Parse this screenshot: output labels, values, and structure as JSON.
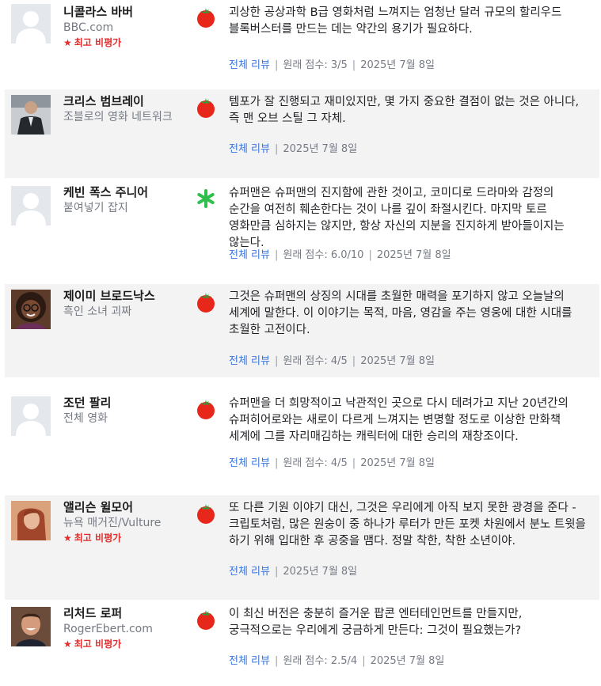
{
  "reviews": [
    {
      "critic": "니콜라스 바버",
      "publication": "BBC.com",
      "top_critic": "최고 비평가",
      "sentiment": "fresh",
      "avatar": "default-avatar",
      "quote": "괴상한 공상과학 B급 영화처럼 느껴지는 엄청난 달러 규모의 할리우드 블록버스터를 만드는 데는 약간의 용기가 필요하다.",
      "full_review": "전체 리뷰",
      "original_score": "원래 점수: 3/5",
      "date": "2025년 7월 8일"
    },
    {
      "critic": "크리스 범브레이",
      "publication": "조블로의 영화 네트워크",
      "top_critic": "",
      "sentiment": "fresh",
      "avatar": "photo-dark-suit",
      "quote": "템포가 잘 진행되고 재미있지만, 몇 가지 중요한 결점이 없는 것은 아니다, 즉 맨 오브 스틸 그 자체.",
      "full_review": "전체 리뷰",
      "original_score": "",
      "date": "2025년 7월 8일"
    },
    {
      "critic": "케빈 폭스 주니어",
      "publication": "붙여넣기 잡지",
      "top_critic": "",
      "sentiment": "rotten",
      "avatar": "default-avatar",
      "quote": "슈퍼맨은 슈퍼맨의 진지함에 관한 것이고, 코미디로 드라마와 감정의 순간을 여전히 훼손한다는 것이 나를 깊이 좌절시킨다. 마지막 토르 영화만큼 심하지는 않지만, 항상 자신의 지분을 진지하게 받아들이지는 않는다.",
      "full_review": "전체 리뷰",
      "original_score": "원래 점수: 6.0/10",
      "date": "2025년 7월 8일"
    },
    {
      "critic": "제이미 브로드낙스",
      "publication": "흑인 소녀 괴짜",
      "top_critic": "",
      "sentiment": "fresh",
      "avatar": "photo-woman-glasses",
      "quote": "그것은 슈퍼맨의 상징의 시대를 초월한 매력을 포기하지 않고 오늘날의 세계에 말한다. 이 이야기는 목적, 마음, 영감을 주는 영웅에 대한 시대를 초월한 고전이다.",
      "full_review": "전체 리뷰",
      "original_score": "원래 점수: 4/5",
      "date": "2025년 7월 8일"
    },
    {
      "critic": "조던 팔리",
      "publication": "전체 영화",
      "top_critic": "",
      "sentiment": "fresh",
      "avatar": "default-avatar",
      "quote": "슈퍼맨을 더 희망적이고 낙관적인 곳으로 다시 데려가고 지난 20년간의 슈퍼히어로와는 새로이 다르게 느껴지는 변명할 정도로 이상한 만화책 세계에 그를 자리매김하는 캐릭터에 대한 승리의 재창조이다.",
      "full_review": "전체 리뷰",
      "original_score": "원래 점수: 4/5",
      "date": "2025년 7월 8일"
    },
    {
      "critic": "앨리슨 윌모어",
      "publication": "뉴욕 매거진/Vulture",
      "top_critic": "최고 비평가",
      "sentiment": "fresh",
      "avatar": "photo-woman-red-hair",
      "quote": "또 다른 기원 이야기 대신, 그것은 우리에게 아직 보지 못한 광경을 준다 - 크립토처럼, 많은 원숭이 중 하나가 루터가 만든 포켓 차원에서 분노 트윗을 하기 위해 입대한 후 공중을 맴다. 정말 착한, 착한 소년이야.",
      "full_review": "전체 리뷰",
      "original_score": "",
      "date": "2025년 7월 8일"
    },
    {
      "critic": "리처드 로퍼",
      "publication": "RogerEbert.com",
      "top_critic": "최고 비평가",
      "sentiment": "fresh",
      "avatar": "photo-man-smiling",
      "quote": "이 최신 버전은 충분히 즐거운 팝콘 엔터테인먼트를 만들지만, 궁극적으로는 우리에게 궁금하게 만든다: 그것이 필요했는가?",
      "full_review": "전체 리뷰",
      "original_score": "원래 점수: 2.5/4",
      "date": "2025년 7월 8일"
    }
  ],
  "colors": {
    "fresh_tomato": "#e8271b",
    "tomato_leaf": "#2f9e3c",
    "rotten_splat": "#2fbf4a",
    "link": "#3976dc",
    "top_critic": "#e32d2d",
    "shaded_row": "#f3f3f3"
  }
}
